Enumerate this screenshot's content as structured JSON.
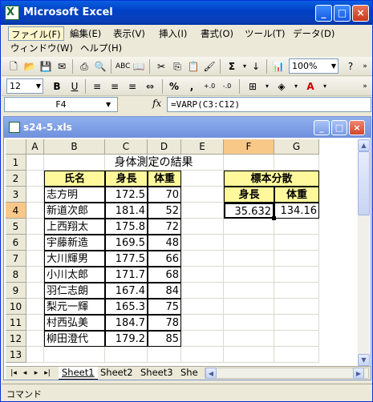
{
  "app": {
    "title": "Microsoft Excel"
  },
  "menu": {
    "row1": [
      "ファイル(F)",
      "編集(E)",
      "表示(V)",
      "挿入(I)",
      "書式(O)",
      "ツール(T)",
      "データ(D)"
    ],
    "row2": [
      "ウィンドウ(W)",
      "ヘルプ(H)"
    ]
  },
  "toolbar": {
    "zoom": "100%",
    "font_size": "12",
    "bold": "B",
    "underline": "U",
    "percent": "%",
    "comma": ","
  },
  "formula_bar": {
    "name_box": "F4",
    "fx": "fx",
    "formula": "=VARP(C3:C12)"
  },
  "workbook": {
    "title": "s24-5.xls"
  },
  "sheet": {
    "columns": [
      "A",
      "B",
      "C",
      "D",
      "E",
      "F",
      "G"
    ],
    "rows": [
      "1",
      "2",
      "3",
      "4",
      "5",
      "6",
      "7",
      "8",
      "9",
      "10",
      "11",
      "12",
      "13"
    ],
    "title": "身体測定の結果",
    "headers": {
      "name": "氏名",
      "height": "身長",
      "weight": "体重"
    },
    "data": [
      {
        "name": "志方明",
        "height": "172.5",
        "weight": "70"
      },
      {
        "name": "新道次郎",
        "height": "181.4",
        "weight": "52"
      },
      {
        "name": "上西翔太",
        "height": "175.8",
        "weight": "72"
      },
      {
        "name": "宇藤新造",
        "height": "169.5",
        "weight": "48"
      },
      {
        "name": "大川輝男",
        "height": "177.5",
        "weight": "66"
      },
      {
        "name": "小川太郎",
        "height": "171.7",
        "weight": "68"
      },
      {
        "name": "羽仁志朗",
        "height": "167.4",
        "weight": "84"
      },
      {
        "name": "梨元一輝",
        "height": "165.3",
        "weight": "75"
      },
      {
        "name": "村西弘美",
        "height": "184.7",
        "weight": "78"
      },
      {
        "name": "柳田澄代",
        "height": "179.2",
        "weight": "85"
      }
    ],
    "summary": {
      "title": "標本分散",
      "height_label": "身長",
      "weight_label": "体重",
      "height_value": "35.632",
      "weight_value": "134.16"
    }
  },
  "tabs": [
    "Sheet1",
    "Sheet2",
    "Sheet3",
    "She"
  ],
  "status": {
    "text": "コマンド"
  }
}
